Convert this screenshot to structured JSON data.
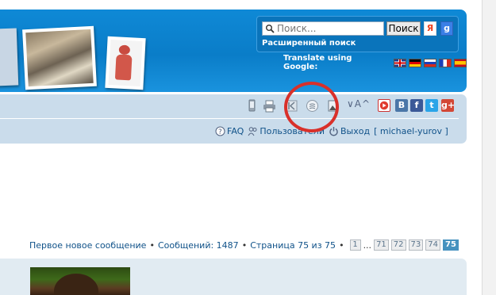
{
  "search": {
    "placeholder": "Поиск...",
    "button_label": "Поиск",
    "yandex_label": "Я",
    "google_label": "g",
    "advanced_label": "Расширенный поиск"
  },
  "translate": {
    "label": "Translate using Google:",
    "flags": [
      "flag-en-icon",
      "flag-de-icon",
      "flag-ru-icon",
      "flag-fr-icon",
      "flag-es-icon"
    ]
  },
  "toolbar": {
    "icons": [
      "mobile-icon",
      "print-icon",
      "back-to-top-icon",
      "rss-icon",
      "image-icon"
    ],
    "font_size_label": "∨A^",
    "social": {
      "vk": "B",
      "facebook": "f",
      "twitter": "t",
      "googleplus": "g+"
    }
  },
  "user_links": {
    "faq": "FAQ",
    "members": "Пользователи",
    "logout": "Выход",
    "username": "[ michael-yurov ]"
  },
  "pagination": {
    "first_unread": "Первое новое сообщение",
    "messages": "Сообщений: 1487",
    "page_info": "Страница 75 из 75",
    "pages": [
      "1",
      "71",
      "72",
      "73",
      "74"
    ],
    "current_page": "75",
    "dots": "..."
  },
  "colors": {
    "header_blue": "#0f89d6",
    "nav_bg": "#cadceb",
    "highlight_red": "#d9302a",
    "current_page": "#4692bf"
  }
}
